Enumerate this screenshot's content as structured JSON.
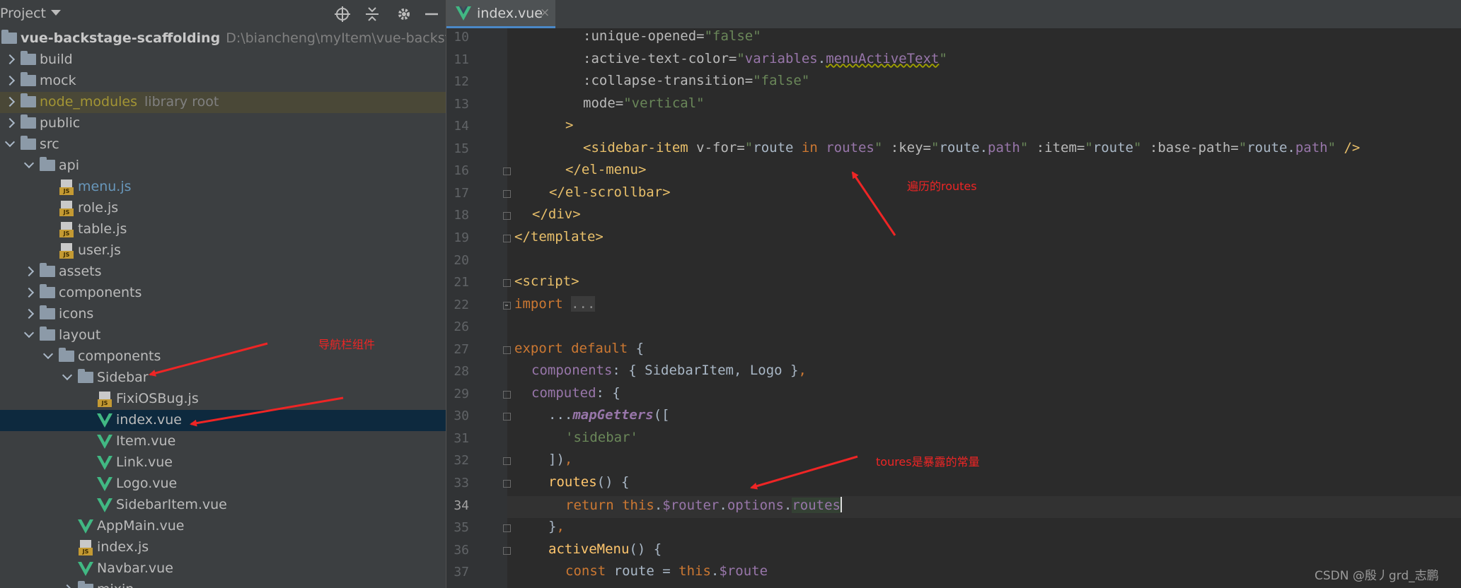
{
  "project_panel": {
    "title": "Project",
    "toolbar_icons": [
      "locate-icon",
      "collapse-all-icon",
      "settings-icon",
      "minimize-icon"
    ],
    "tree": [
      {
        "label": "vue-backstage-scaffolding",
        "extra": "D:\\biancheng\\myItem\\vue-backstage-scaffolding",
        "kind": "folder",
        "expanded": true,
        "depth": 0,
        "style": "bold"
      },
      {
        "label": "build",
        "kind": "folder",
        "expanded": false,
        "depth": 1
      },
      {
        "label": "mock",
        "kind": "folder",
        "expanded": false,
        "depth": 1
      },
      {
        "label": "node_modules",
        "extra": "library root",
        "kind": "folder",
        "expanded": false,
        "depth": 1,
        "style": "excluded"
      },
      {
        "label": "public",
        "kind": "folder",
        "expanded": false,
        "depth": 1
      },
      {
        "label": "src",
        "kind": "folder",
        "expanded": true,
        "depth": 1
      },
      {
        "label": "api",
        "kind": "folder",
        "expanded": true,
        "depth": 2
      },
      {
        "label": "menu.js",
        "kind": "js",
        "depth": 3,
        "style": "modified"
      },
      {
        "label": "role.js",
        "kind": "js",
        "depth": 3
      },
      {
        "label": "table.js",
        "kind": "js",
        "depth": 3
      },
      {
        "label": "user.js",
        "kind": "js",
        "depth": 3
      },
      {
        "label": "assets",
        "kind": "folder",
        "expanded": false,
        "depth": 2
      },
      {
        "label": "components",
        "kind": "folder",
        "expanded": false,
        "depth": 2
      },
      {
        "label": "icons",
        "kind": "folder",
        "expanded": false,
        "depth": 2
      },
      {
        "label": "layout",
        "kind": "folder",
        "expanded": true,
        "depth": 2
      },
      {
        "label": "components",
        "kind": "folder",
        "expanded": true,
        "depth": 3
      },
      {
        "label": "Sidebar",
        "kind": "folder",
        "expanded": true,
        "depth": 4
      },
      {
        "label": "FixiOSBug.js",
        "kind": "js",
        "depth": 5
      },
      {
        "label": "index.vue",
        "kind": "vue",
        "depth": 5,
        "selected": true
      },
      {
        "label": "Item.vue",
        "kind": "vue",
        "depth": 5
      },
      {
        "label": "Link.vue",
        "kind": "vue",
        "depth": 5
      },
      {
        "label": "Logo.vue",
        "kind": "vue",
        "depth": 5
      },
      {
        "label": "SidebarItem.vue",
        "kind": "vue",
        "depth": 5
      },
      {
        "label": "AppMain.vue",
        "kind": "vue",
        "depth": 4
      },
      {
        "label": "index.js",
        "kind": "js",
        "depth": 4
      },
      {
        "label": "Navbar.vue",
        "kind": "vue",
        "depth": 4
      },
      {
        "label": "mixin",
        "kind": "folder",
        "expanded": false,
        "depth": 4
      }
    ]
  },
  "editor": {
    "tab": {
      "label": "index.vue",
      "close": "×"
    },
    "current_line": 34,
    "lines": [
      {
        "n": "10",
        "tokens": [
          [
            "attr",
            ":unique-opened="
          ],
          [
            "str",
            "\"false\""
          ]
        ]
      },
      {
        "n": "11",
        "tokens": [
          [
            "attr",
            ":active-text-color="
          ],
          [
            "str",
            "\""
          ],
          [
            "prop",
            "variables"
          ],
          [
            "plain",
            "."
          ],
          [
            "prop-u",
            "menuActiveText"
          ],
          [
            "str",
            "\""
          ]
        ]
      },
      {
        "n": "12",
        "tokens": [
          [
            "attr",
            ":collapse-transition="
          ],
          [
            "str",
            "\"false\""
          ]
        ]
      },
      {
        "n": "13",
        "tokens": [
          [
            "attr",
            "mode="
          ],
          [
            "str",
            "\"vertical\""
          ]
        ]
      },
      {
        "n": "14",
        "tokens": [
          [
            "tag",
            ">"
          ]
        ]
      },
      {
        "n": "15",
        "tokens": [
          [
            "tag",
            "<sidebar-item "
          ],
          [
            "attr",
            "v-for="
          ],
          [
            "str",
            "\""
          ],
          [
            "plain",
            "route "
          ],
          [
            "kw",
            "in "
          ],
          [
            "prop",
            "routes"
          ],
          [
            "str",
            "\" "
          ],
          [
            "attr",
            ":key="
          ],
          [
            "str",
            "\""
          ],
          [
            "plain",
            "route."
          ],
          [
            "prop",
            "path"
          ],
          [
            "str",
            "\" "
          ],
          [
            "attr",
            ":item="
          ],
          [
            "str",
            "\""
          ],
          [
            "plain",
            "route"
          ],
          [
            "str",
            "\" "
          ],
          [
            "attr",
            ":base-path="
          ],
          [
            "str",
            "\""
          ],
          [
            "plain",
            "route."
          ],
          [
            "prop",
            "path"
          ],
          [
            "str",
            "\" "
          ],
          [
            "tag",
            "/>"
          ]
        ]
      },
      {
        "n": "16",
        "tokens": [
          [
            "tag",
            "</el-menu>"
          ]
        ]
      },
      {
        "n": "17",
        "tokens": [
          [
            "tag",
            "</el-scrollbar>"
          ]
        ]
      },
      {
        "n": "18",
        "tokens": [
          [
            "tag",
            "</div>"
          ]
        ]
      },
      {
        "n": "19",
        "tokens": [
          [
            "tag",
            "</template>"
          ]
        ]
      },
      {
        "n": "20",
        "tokens": []
      },
      {
        "n": "21",
        "tokens": [
          [
            "tag",
            "<script>"
          ]
        ]
      },
      {
        "n": "22",
        "tokens": [
          [
            "kw",
            "import "
          ],
          [
            "fold",
            "..."
          ]
        ]
      },
      {
        "n": "26",
        "tokens": []
      },
      {
        "n": "27",
        "tokens": [
          [
            "kw",
            "export default "
          ],
          [
            "plain",
            "{"
          ]
        ]
      },
      {
        "n": "28",
        "tokens": [
          [
            "prop",
            "components"
          ],
          [
            "plain",
            ": { SidebarItem, Logo }"
          ],
          [
            "kw",
            ","
          ]
        ]
      },
      {
        "n": "29",
        "tokens": [
          [
            "prop",
            "computed"
          ],
          [
            "plain",
            ": {"
          ]
        ]
      },
      {
        "n": "30",
        "tokens": [
          [
            "plain",
            "..."
          ],
          [
            "ital",
            "mapGetters"
          ],
          [
            "plain",
            "(["
          ]
        ]
      },
      {
        "n": "31",
        "tokens": [
          [
            "str",
            "'sidebar'"
          ]
        ]
      },
      {
        "n": "32",
        "tokens": [
          [
            "plain",
            "])"
          ],
          [
            "kw",
            ","
          ]
        ]
      },
      {
        "n": "33",
        "tokens": [
          [
            "fn",
            "routes"
          ],
          [
            "plain",
            "() {"
          ]
        ]
      },
      {
        "n": "34",
        "tokens": [
          [
            "kw",
            "return this"
          ],
          [
            "plain",
            "."
          ],
          [
            "prop",
            "$router"
          ],
          [
            "plain",
            "."
          ],
          [
            "prop",
            "options"
          ],
          [
            "plain",
            "."
          ],
          [
            "prop-hl",
            "routes"
          ],
          [
            "caret",
            ""
          ]
        ]
      },
      {
        "n": "35",
        "tokens": [
          [
            "plain",
            "}"
          ],
          [
            "kw",
            ","
          ]
        ]
      },
      {
        "n": "36",
        "tokens": [
          [
            "fn",
            "activeMenu"
          ],
          [
            "plain",
            "() {"
          ]
        ]
      },
      {
        "n": "37",
        "tokens": [
          [
            "kw",
            "const "
          ],
          [
            "plain",
            "route = "
          ],
          [
            "kw",
            "this"
          ],
          [
            "plain",
            "."
          ],
          [
            "prop",
            "$route"
          ]
        ]
      }
    ]
  },
  "annotations": {
    "nav_component": "导航栏组件",
    "iterated_routes": "遍历的routes",
    "exposed_routes": "toures是暴露的常量"
  },
  "watermark": "CSDN @殷丿grd_志鹏",
  "colors": {
    "annotation": "#ee2525",
    "selection": "#0d293e",
    "tab_underline": "#4a88c7"
  }
}
